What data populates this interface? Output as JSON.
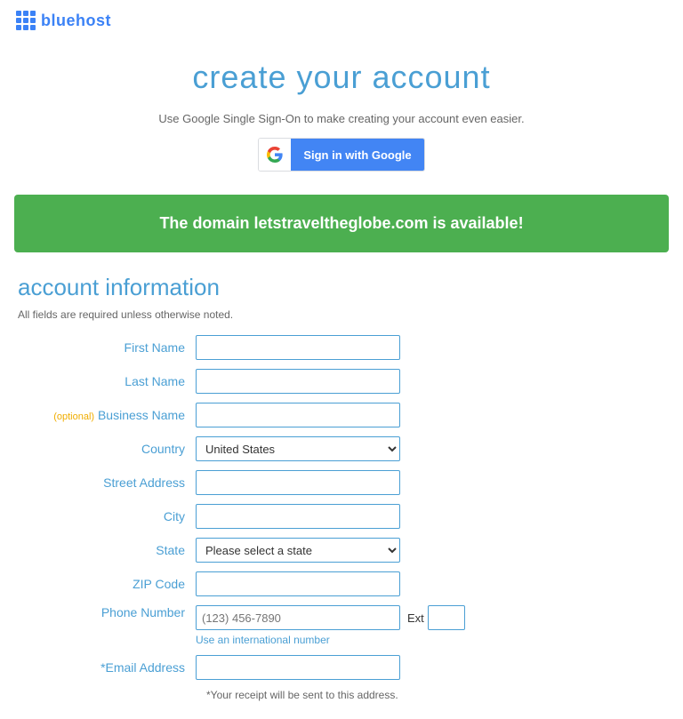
{
  "header": {
    "logo_text": "bluehost"
  },
  "title_section": {
    "page_title": "create your account",
    "google_sso_text": "Use Google Single Sign-On to make creating your account even easier.",
    "google_btn_label": "Sign in with Google"
  },
  "domain_banner": {
    "text": "The domain letstraveltheglobe.com is available!"
  },
  "account_info": {
    "section_title": "account information",
    "required_note": "All fields are required unless otherwise noted.",
    "fields": {
      "first_name_label": "First Name",
      "last_name_label": "Last Name",
      "business_name_label": "Business Name",
      "business_name_optional": "(optional)",
      "country_label": "Country",
      "country_default": "United States",
      "street_address_label": "Street Address",
      "city_label": "City",
      "state_label": "State",
      "state_default": "Please select a state",
      "zip_label": "ZIP Code",
      "phone_label": "Phone Number",
      "phone_placeholder": "(123) 456-7890",
      "ext_label": "Ext",
      "intl_link": "Use an international number",
      "email_label": "*Email Address",
      "email_note": "*Your receipt will be sent to this address."
    }
  }
}
